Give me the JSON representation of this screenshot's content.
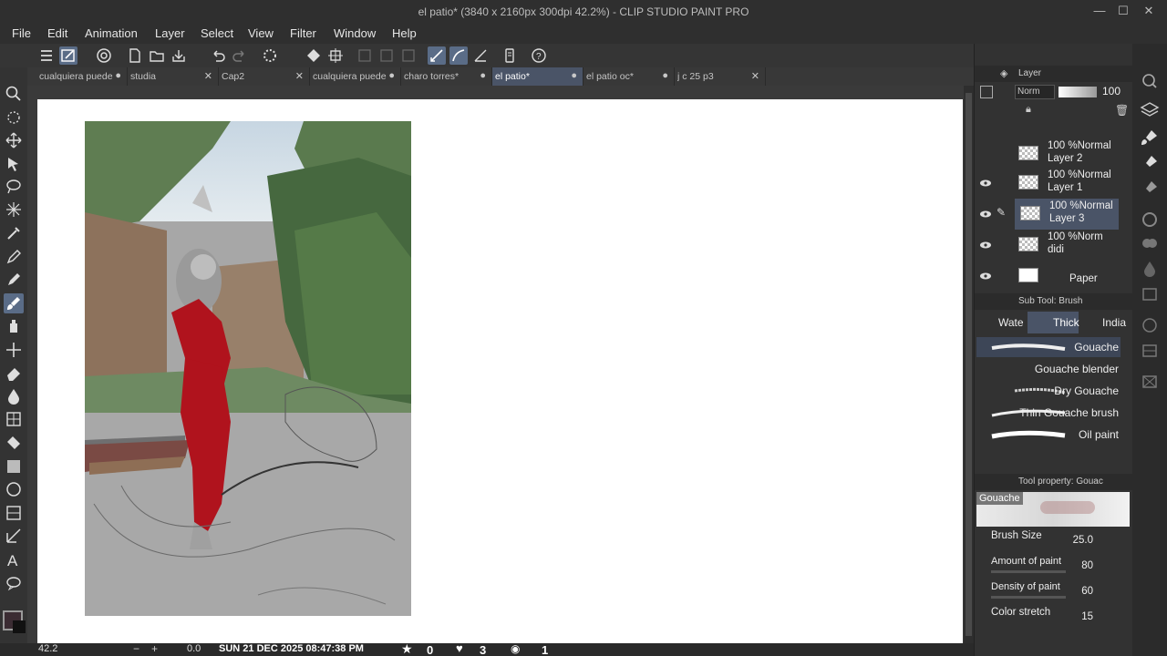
{
  "window": {
    "title": "el patio* (3840 x 2160px 300dpi 42.2%)  - CLIP STUDIO PAINT PRO",
    "min_glyph": "—",
    "max_glyph": "☐",
    "close_glyph": "✕"
  },
  "menu": [
    "File",
    "Edit",
    "Animation",
    "Layer",
    "Select",
    "View",
    "Filter",
    "Window",
    "Help"
  ],
  "tabs": [
    {
      "label": "cualquiera puede",
      "mark": "●",
      "active": false
    },
    {
      "label": "studia",
      "mark": "✕",
      "active": false
    },
    {
      "label": "Cap2",
      "mark": "✕",
      "active": false
    },
    {
      "label": "cualquiera puede",
      "mark": "●",
      "active": false
    },
    {
      "label": "charo torres*",
      "mark": "●",
      "active": false
    },
    {
      "label": "el patio*",
      "mark": "●",
      "active": true
    },
    {
      "label": "el patio oc*",
      "mark": "●",
      "active": false
    },
    {
      "label": "j c 25 p3",
      "mark": "✕",
      "active": false
    }
  ],
  "status": {
    "zoom": "42.2",
    "angle": "0.0",
    "datetime": "SUN 21 DEC 2025 08:47:38 PM",
    "stars": "0",
    "hearts": "3",
    "views": "1"
  },
  "layer_panel": {
    "title": "Layer",
    "blend_mode": "Norm",
    "opacity": "100",
    "layers": [
      {
        "line1": "100 %Normal",
        "line2": "Layer 2",
        "visible": false,
        "selected": false
      },
      {
        "line1": "100 %Normal",
        "line2": "Layer 1",
        "visible": true,
        "selected": false
      },
      {
        "line1": "100 %Normal",
        "line2": "Layer 3",
        "visible": true,
        "selected": true
      },
      {
        "line1": "100 %Norm",
        "line2": "didi",
        "visible": true,
        "selected": false
      },
      {
        "line1": "",
        "line2": "Paper",
        "visible": true,
        "selected": false
      }
    ]
  },
  "subtool_panel": {
    "title": "Sub Tool: Brush",
    "tabs": [
      "Wate",
      "Thick",
      "India"
    ],
    "brushes": [
      {
        "name": "Gouache",
        "selected": true
      },
      {
        "name": "Gouache blender",
        "selected": false
      },
      {
        "name": "Dry Gouache",
        "selected": false
      },
      {
        "name": "Thin Gouache brush",
        "selected": false
      },
      {
        "name": "Oil paint",
        "selected": false
      }
    ]
  },
  "tool_property": {
    "title": "Tool property: Gouac",
    "preview_name": "Gouache",
    "props": [
      {
        "label": "Brush Size",
        "value": "25.0"
      },
      {
        "label": "Amount of paint",
        "value": "80"
      },
      {
        "label": "Density of paint",
        "value": "60"
      },
      {
        "label": "Color stretch",
        "value": "15"
      }
    ]
  },
  "colors": {
    "accent": "#5a6c87",
    "selected_layer": "#4a5467",
    "paint_red": "#b0131d"
  }
}
